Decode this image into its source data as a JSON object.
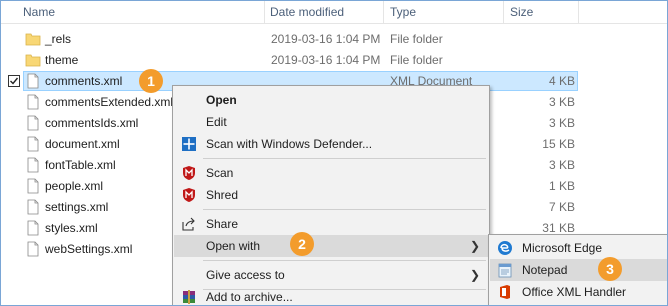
{
  "columns": {
    "name": "Name",
    "date_modified": "Date modified",
    "type": "Type",
    "size": "Size"
  },
  "files": [
    {
      "name": "_rels",
      "date": "2019-03-16 1:04 PM",
      "type": "File folder",
      "size": "",
      "kind": "folder"
    },
    {
      "name": "theme",
      "date": "2019-03-16 1:04 PM",
      "type": "File folder",
      "size": "",
      "kind": "folder"
    },
    {
      "name": "comments.xml",
      "date": "",
      "type": "XML Document",
      "size": "4 KB",
      "kind": "file",
      "selected": true
    },
    {
      "name": "commentsExtended.xml",
      "date": "",
      "type": "",
      "size": "3 KB",
      "kind": "file"
    },
    {
      "name": "commentsIds.xml",
      "date": "",
      "type": "",
      "size": "3 KB",
      "kind": "file"
    },
    {
      "name": "document.xml",
      "date": "",
      "type": "",
      "size": "15 KB",
      "kind": "file"
    },
    {
      "name": "fontTable.xml",
      "date": "",
      "type": "",
      "size": "3 KB",
      "kind": "file"
    },
    {
      "name": "people.xml",
      "date": "",
      "type": "",
      "size": "1 KB",
      "kind": "file"
    },
    {
      "name": "settings.xml",
      "date": "",
      "type": "",
      "size": "7 KB",
      "kind": "file"
    },
    {
      "name": "styles.xml",
      "date": "",
      "type": "",
      "size": "31 KB",
      "kind": "file"
    },
    {
      "name": "webSettings.xml",
      "date": "",
      "type": "",
      "size": "",
      "kind": "file"
    }
  ],
  "context_menu": {
    "open": "Open",
    "edit": "Edit",
    "scan_defender": "Scan with Windows Defender...",
    "scan": "Scan",
    "shred": "Shred",
    "share": "Share",
    "open_with": "Open with",
    "give_access": "Give access to",
    "add_archive": "Add to archive..."
  },
  "open_with_menu": {
    "edge": "Microsoft Edge",
    "notepad": "Notepad",
    "office_xml": "Office XML Handler"
  },
  "callouts": [
    "1",
    "2",
    "3"
  ],
  "colors": {
    "selection": "#cce8ff",
    "callout": "#f39c2c",
    "folder": "#f8d775",
    "mcafee": "#c01818",
    "defender": "#1e6fc4",
    "edge": "#1f7ad1"
  },
  "icons": {
    "folder": "folder-icon",
    "file": "document-icon",
    "defender": "windows-defender-icon",
    "mcafee": "mcafee-shield-icon",
    "share": "share-icon",
    "archive": "winrar-archive-icon",
    "edge": "microsoft-edge-icon",
    "notepad": "notepad-icon",
    "office": "office-xml-handler-icon"
  }
}
